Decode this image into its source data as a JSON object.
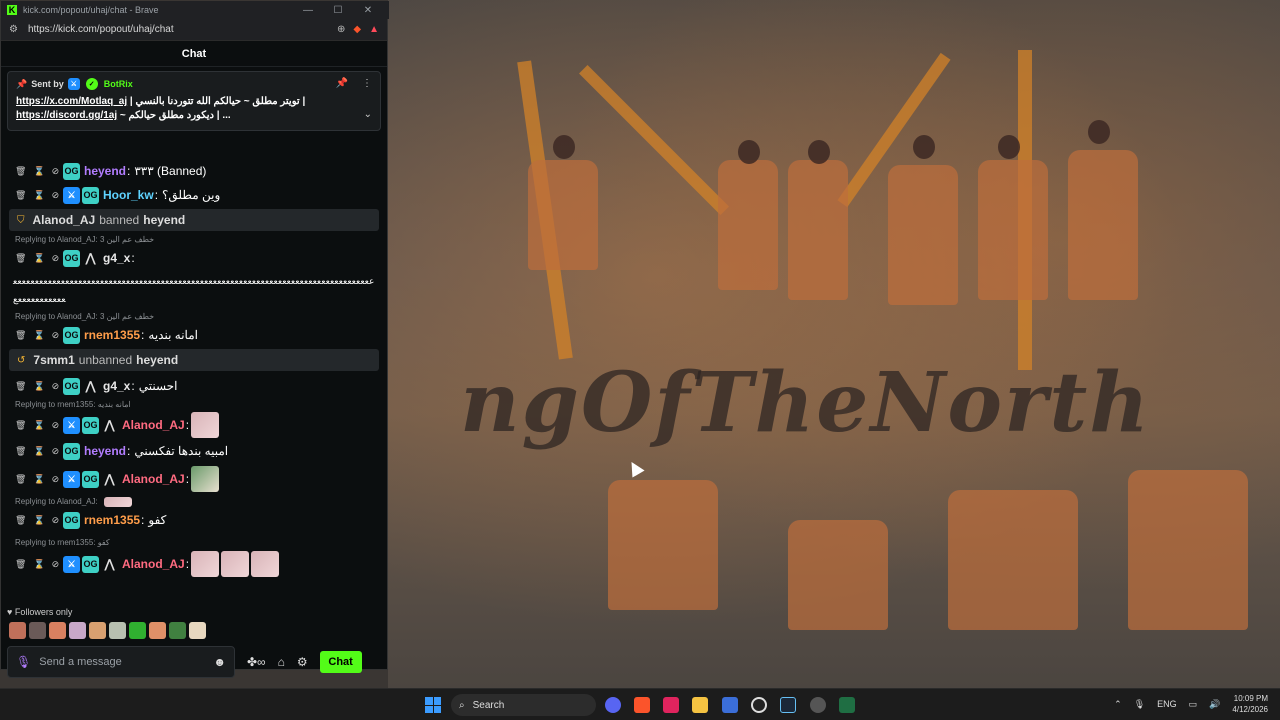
{
  "window": {
    "title": "kick.com/popout/uhaj/chat - Brave",
    "url": "https://kick.com/popout/uhaj/chat"
  },
  "chat": {
    "header": "Chat",
    "pinned": {
      "sent_by": "Sent by",
      "bot_name": "BotRix",
      "line1_link": "https://x.com/Motlaq_aj",
      "line1_text": "| تويتر مطلق ~ حيالكم الله تتوردنا بالنسي |",
      "line2_link": "https://discord.gg/1aj",
      "line2_text": "~ ديكورد مطلق حيالكم | ..."
    },
    "messages": [
      {
        "user": "heyend",
        "text": "٣٣٣ (Banned)",
        "color": "purple"
      },
      {
        "user": "Hoor_kw",
        "text": "وين مطلق؟",
        "color": "teal"
      }
    ],
    "sys1": {
      "actor": "Alanod_AJ",
      "action": "banned",
      "target": "heyend"
    },
    "reply1": "Replying to Alanod_AJ: 3 خطف عم الين",
    "msg3": {
      "user": "g4_x",
      "text": "ععععععععععععععععععععععععععععععععععععععععععععععععععععععععععععععععععععععععععععععععععععععععععععععع"
    },
    "reply2": "Replying to Alanod_AJ: 3 خطف عم الين",
    "msg4": {
      "user": "rnem1355",
      "text": "امانه بنديه"
    },
    "sys2": {
      "actor": "7smm1",
      "action": "unbanned",
      "target": "heyend"
    },
    "msg5": {
      "user": "g4_x",
      "text": "احسنتي"
    },
    "reply3": "Replying to rnem1355: امانه بنديه",
    "msg6": {
      "user": "Alanod_AJ",
      "text": ""
    },
    "msg7": {
      "user": "heyend",
      "text": "امبيه بندها تفكسني"
    },
    "msg8": {
      "user": "Alanod_AJ",
      "text": ""
    },
    "reply4": "Replying to Alanod_AJ:",
    "msg9": {
      "user": "rnem1355",
      "text": "كفو"
    },
    "reply5": "Replying to rnem1355: كفو",
    "msg10": {
      "user": "Alanod_AJ",
      "text": ""
    },
    "followers_only": "Followers only",
    "input_placeholder": "Send a message",
    "chat_button": "Chat"
  },
  "background": {
    "banner": "ngOfTheNorth"
  },
  "taskbar": {
    "search": "Search",
    "lang": "ENG",
    "time": "10:09 PM",
    "date": "4/12/2026"
  },
  "colors": {
    "kick_green": "#53fc18",
    "og_badge": "#3ed0c5",
    "mod_badge": "#1f8fff"
  }
}
